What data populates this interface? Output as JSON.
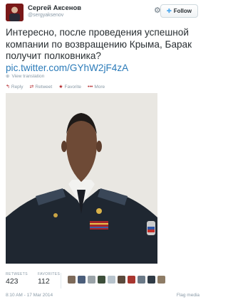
{
  "header": {
    "display_name": "Сергей Аксенов",
    "screen_name": "@sergyaksenov",
    "settings_icon": "gear-icon",
    "follow_label": "Follow"
  },
  "tweet": {
    "text": "Интересно, после проведения успешной компании по возвращению Крыма, Барак получит полковника?",
    "link": "pic.twitter.com/GYhW2jF4zA",
    "translate_label": "View translation"
  },
  "actions": {
    "reply": "Reply",
    "retweet": "Retweet",
    "favorite": "Favorite",
    "more": "More"
  },
  "stats": {
    "retweets_label": "RETWEETS",
    "retweets": "423",
    "favorites_label": "FAVORITES",
    "favorites": "112"
  },
  "footer": {
    "timestamp": "8:10 AM - 17 Mar 2014",
    "flag": "Flag media"
  },
  "colors": {
    "link": "#2b7bb9",
    "action_icon": "#b4292d",
    "muted": "#8899a6"
  }
}
